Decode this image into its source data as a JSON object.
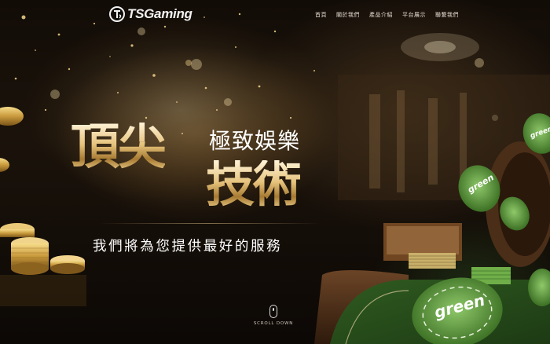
{
  "brand": {
    "name": "TSGaming"
  },
  "nav": {
    "items": [
      {
        "label": "首頁"
      },
      {
        "label": "關於我們"
      },
      {
        "label": "產品介紹"
      },
      {
        "label": "平台展示"
      },
      {
        "label": "聯繫我們"
      }
    ]
  },
  "hero": {
    "headline_top": "頂尖",
    "headline_sub": "極致娛樂",
    "headline_main": "技術",
    "tagline": "我們將為您提供最好的服務",
    "chip_text": "green"
  },
  "scroll": {
    "label": "SCROLL DOWN"
  },
  "colors": {
    "gold": "#e6c37d",
    "table_green": "#3f7a2a",
    "chip_green": "#5f9b3c"
  }
}
